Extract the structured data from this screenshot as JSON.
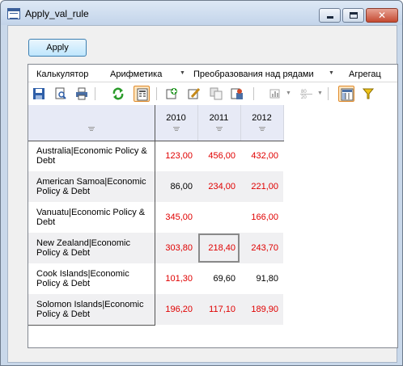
{
  "window": {
    "title": "Apply_val_rule",
    "minimize_glyph": "",
    "maximize_glyph": "",
    "close_glyph": "✕"
  },
  "apply_button": {
    "label": "Apply"
  },
  "menu": [
    {
      "label": "Калькулятор",
      "has_dropdown": false
    },
    {
      "label": "Арифметика",
      "has_dropdown": true
    },
    {
      "label": "Преобразования над рядами",
      "has_dropdown": true
    },
    {
      "label": "Агрегац",
      "has_dropdown": false
    }
  ],
  "toolbar": {
    "icons": [
      "save-icon",
      "print-preview-icon",
      "print-icon",
      "refresh-icon",
      "grid-view-icon",
      "add-series-icon",
      "edit-icon",
      "copy-icon",
      "series-settings-icon",
      "chart-icon",
      "decimal-format-icon",
      "table-layout-icon",
      "filter-icon"
    ],
    "active_icons": [
      "grid-view-icon",
      "table-layout-icon"
    ],
    "decimal_glyph_top": "80",
    "decimal_glyph_bottom": "20"
  },
  "grid": {
    "columns": [
      "2010",
      "2011",
      "2012"
    ],
    "rows": [
      {
        "label": "Australia|Economic Policy & Debt",
        "values": [
          "123,00",
          "456,00",
          "432,00"
        ],
        "colors": [
          "red",
          "red",
          "red"
        ]
      },
      {
        "label": "American Samoa|Economic Policy & Debt",
        "values": [
          "86,00",
          "234,00",
          "221,00"
        ],
        "colors": [
          "black",
          "red",
          "red"
        ]
      },
      {
        "label": "Vanuatu|Economic Policy & Debt",
        "values": [
          "345,00",
          "",
          "166,00"
        ],
        "colors": [
          "red",
          "red",
          "red"
        ]
      },
      {
        "label": "New Zealand|Economic Policy & Debt",
        "values": [
          "303,80",
          "218,40",
          "243,70"
        ],
        "colors": [
          "red",
          "red",
          "red"
        ],
        "selected_col": 1
      },
      {
        "label": "Cook Islands|Economic Policy & Debt",
        "values": [
          "101,30",
          "69,60",
          "91,80"
        ],
        "colors": [
          "red",
          "black",
          "black"
        ]
      },
      {
        "label": "Solomon Islands|Economic Policy & Debt",
        "values": [
          "196,20",
          "117,10",
          "189,90"
        ],
        "colors": [
          "red",
          "red",
          "red"
        ]
      }
    ]
  },
  "colors": {
    "value_highlight": "#e00000",
    "header_bg": "#e7eaf6",
    "active_button": "#fce4bd"
  }
}
